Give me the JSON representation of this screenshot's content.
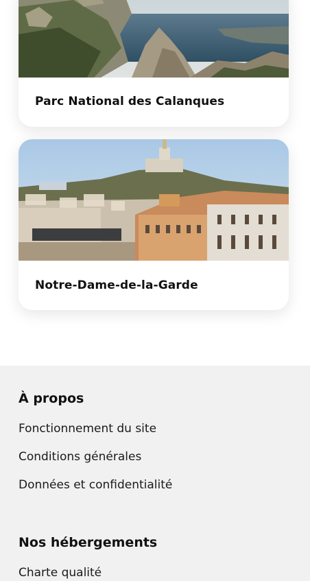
{
  "cards": [
    {
      "title": "Parc National des Calanques",
      "image": "calanques-coastal-cliffs-photo"
    },
    {
      "title": "Notre-Dame-de-la-Garde",
      "image": "marseille-basilica-cityscape-photo"
    }
  ],
  "footer": {
    "about": {
      "heading": "À propos",
      "links": [
        "Fonctionnement du site",
        "Conditions générales",
        "Données et confidentialité"
      ]
    },
    "lodging": {
      "heading": "Nos hébergements",
      "links": [
        "Charte qualité"
      ]
    }
  }
}
